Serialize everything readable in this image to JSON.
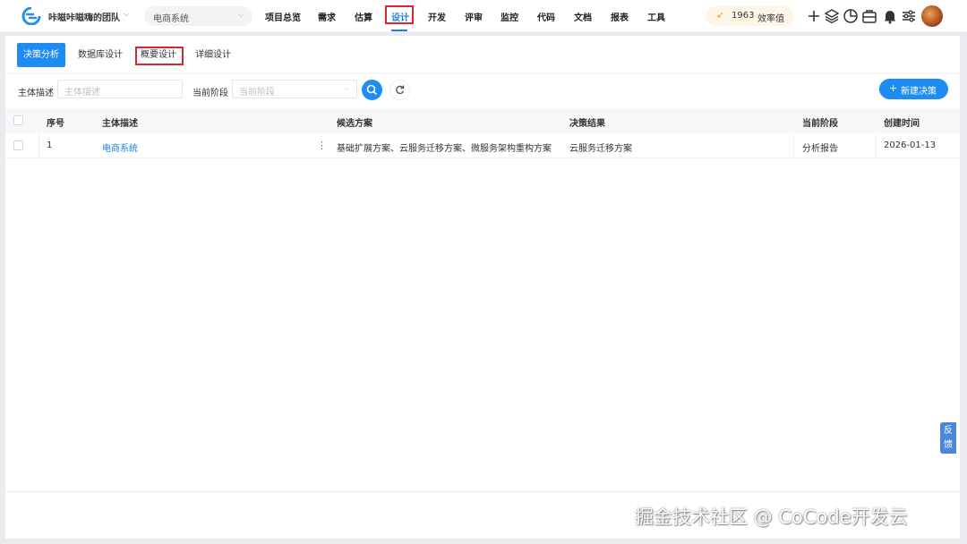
{
  "header": {
    "team_name": "咔嗞咔嗞嗨的团队",
    "project": "电商系统",
    "nav": [
      "项目总览",
      "需求",
      "估算",
      "设计",
      "开发",
      "评审",
      "监控",
      "代码",
      "文档",
      "报表",
      "工具"
    ],
    "active_nav": "设计",
    "efficiency": {
      "value": "1963",
      "label": "效率值"
    },
    "icons": [
      "plus-icon",
      "layers-icon",
      "pie-chart-icon",
      "toolbox-icon",
      "bell-icon",
      "sliders-icon"
    ]
  },
  "tabs": [
    "决策分析",
    "数据库设计",
    "概要设计",
    "详细设计"
  ],
  "active_tab": "决策分析",
  "filters": {
    "subject_label": "主体描述",
    "subject_placeholder": "主体描述",
    "stage_label": "当前阶段",
    "stage_placeholder": "当前阶段"
  },
  "new_button_label": "新建决策",
  "table": {
    "columns": [
      "序号",
      "主体描述",
      "候选方案",
      "决策结果",
      "当前阶段",
      "创建时间"
    ],
    "rows": [
      [
        "1",
        "电商系统",
        "基础扩展方案、云服务迁移方案、微服务架构重构方案",
        "云服务迁移方案",
        "分析报告",
        "2026-01-13"
      ]
    ]
  },
  "feedback_label": "反馈",
  "watermark": "掘金技术社区 @ CoCode开发云",
  "colors": {
    "primary": "#1e8cf0",
    "highlight_box": "#d8262f",
    "efficiency_bg": "#fff5e6"
  }
}
